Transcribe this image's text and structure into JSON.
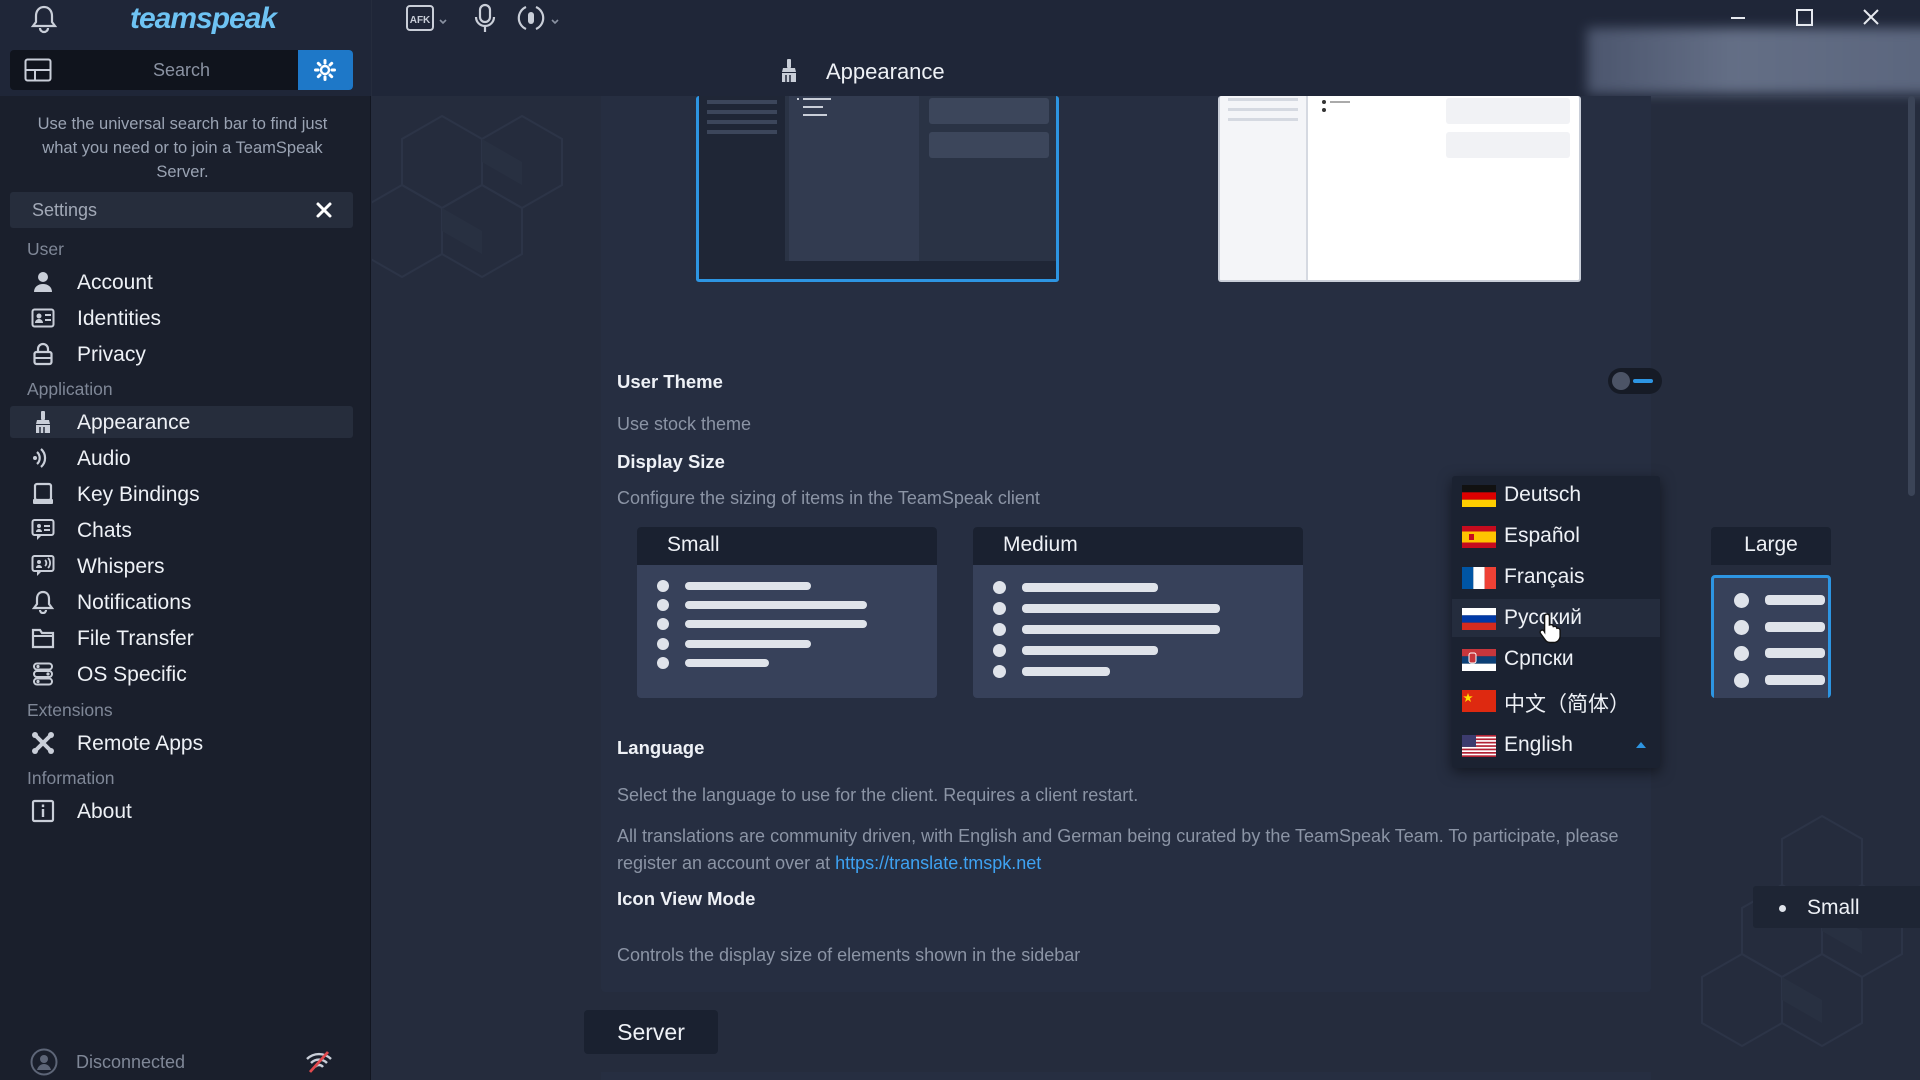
{
  "app": {
    "brand": "teamspeak",
    "search_placeholder": "Search",
    "hint": "Use the universal search bar to find just what you need or to join a TeamSpeak Server.",
    "accent_color": "#2d95e2"
  },
  "sidebar": {
    "settings_title": "Settings",
    "sections": {
      "user": "User",
      "application": "Application",
      "extensions": "Extensions",
      "information": "Information"
    },
    "items": [
      {
        "label": "Account",
        "icon": "account-icon"
      },
      {
        "label": "Identities",
        "icon": "identities-icon"
      },
      {
        "label": "Privacy",
        "icon": "privacy-icon"
      },
      {
        "label": "Appearance",
        "icon": "appearance-icon",
        "active": true
      },
      {
        "label": "Audio",
        "icon": "audio-icon"
      },
      {
        "label": "Key Bindings",
        "icon": "key-bindings-icon"
      },
      {
        "label": "Chats",
        "icon": "chats-icon"
      },
      {
        "label": "Whispers",
        "icon": "whispers-icon"
      },
      {
        "label": "Notifications",
        "icon": "bell-icon"
      },
      {
        "label": "File Transfer",
        "icon": "folder-icon"
      },
      {
        "label": "OS Specific",
        "icon": "os-specific-icon"
      },
      {
        "label": "Remote Apps",
        "icon": "remote-apps-icon"
      },
      {
        "label": "About",
        "icon": "info-icon"
      }
    ],
    "status": "Disconnected"
  },
  "topbar": {
    "afk": "AFK",
    "page_title": "Appearance"
  },
  "appearance": {
    "user_theme_title": "User Theme",
    "user_theme_desc": "Use stock theme",
    "display_size_title": "Display Size",
    "display_size_desc": "Configure the sizing of items in the TeamSpeak client",
    "sizes": [
      "Small",
      "Medium",
      "Large"
    ],
    "language_title": "Language",
    "language_desc": "Select the language to use for the client. Requires a client restart.",
    "translations_desc": "All translations are community driven, with English and German being curated by the TeamSpeak Team. To participate, please register an account over at",
    "translations_link": "https://translate.tmspk.net",
    "languages": [
      "Deutsch",
      "Español",
      "Français",
      "Русский",
      "Српски",
      "中文（简体）",
      "English"
    ],
    "language_selected": "English",
    "icon_view_title": "Icon View Mode",
    "icon_view_desc": "Controls the display size of elements shown in the sidebar",
    "icon_view_value": "Small",
    "server_button": "Server"
  }
}
